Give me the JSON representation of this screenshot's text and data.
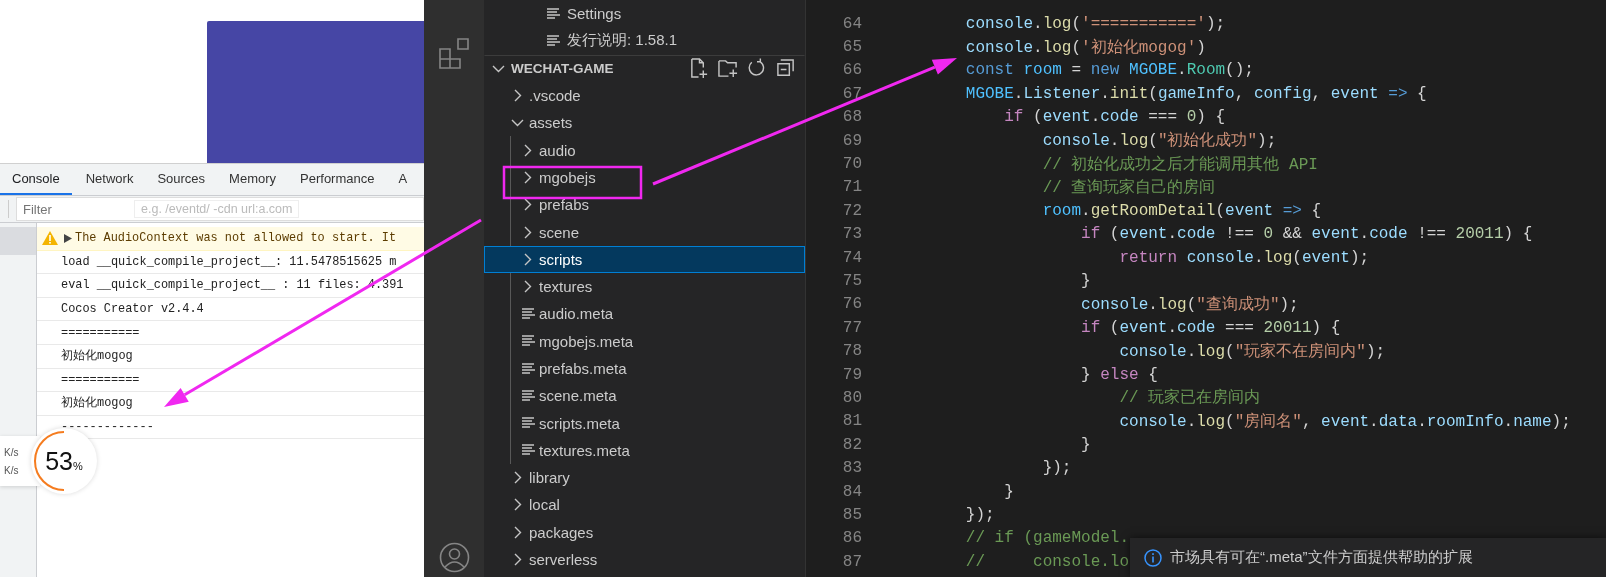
{
  "browser": {
    "devtools": {
      "tabs": [
        {
          "label": "Console",
          "selected": true
        },
        {
          "label": "Network",
          "selected": false
        },
        {
          "label": "Sources",
          "selected": false
        },
        {
          "label": "Memory",
          "selected": false
        },
        {
          "label": "Performance",
          "selected": false
        },
        {
          "label": "A",
          "selected": false
        }
      ],
      "filter": {
        "placeholder": "Filter"
      },
      "filter_hint": "e.g. /eventd/ -cdn url:a.com",
      "console_rows": [
        {
          "kind": "warning",
          "text": "The AudioContext was not allowed to start. It"
        },
        {
          "kind": "log",
          "text": "load __quick_compile_project__: 11.5478515625 m"
        },
        {
          "kind": "log",
          "text": "eval __quick_compile_project__ : 11 files: 4.391"
        },
        {
          "kind": "log",
          "text": "Cocos Creator v2.4.4"
        },
        {
          "kind": "log",
          "text": "==========="
        },
        {
          "kind": "log",
          "text": "初始化mogog"
        },
        {
          "kind": "log",
          "text": "==========="
        },
        {
          "kind": "log",
          "text": "初始化mogog"
        },
        {
          "kind": "log",
          "text": "-------------"
        }
      ]
    },
    "network_widget": {
      "upload_unit": "K/s",
      "download_unit": "K/s",
      "percent": "53",
      "percent_sign": "%",
      "level": 0.5
    }
  },
  "vscode": {
    "explorer": {
      "top_items": [
        {
          "label": "Settings"
        },
        {
          "label": "发行说明: 1.58.1"
        }
      ],
      "section": {
        "title": "WECHAT-GAME",
        "expanded": true
      },
      "tree": [
        {
          "label": ".vscode",
          "kind": "folder",
          "expanded": false,
          "selected": false
        },
        {
          "label": "assets",
          "kind": "folder",
          "expanded": true,
          "selected": false,
          "children": [
            {
              "label": "audio",
              "kind": "folder",
              "expanded": false,
              "selected": false
            },
            {
              "label": "mgobejs",
              "kind": "folder",
              "expanded": false,
              "selected": false
            },
            {
              "label": "prefabs",
              "kind": "folder",
              "expanded": false,
              "selected": false
            },
            {
              "label": "scene",
              "kind": "folder",
              "expanded": false,
              "selected": false
            },
            {
              "label": "scripts",
              "kind": "folder",
              "expanded": false,
              "selected": true
            },
            {
              "label": "textures",
              "kind": "folder",
              "expanded": false,
              "selected": false
            },
            {
              "label": "audio.meta",
              "kind": "file",
              "selected": false
            },
            {
              "label": "mgobejs.meta",
              "kind": "file",
              "selected": false
            },
            {
              "label": "prefabs.meta",
              "kind": "file",
              "selected": false
            },
            {
              "label": "scene.meta",
              "kind": "file",
              "selected": false
            },
            {
              "label": "scripts.meta",
              "kind": "file",
              "selected": false
            },
            {
              "label": "textures.meta",
              "kind": "file",
              "selected": false
            }
          ]
        },
        {
          "label": "library",
          "kind": "folder",
          "expanded": false,
          "selected": false
        },
        {
          "label": "local",
          "kind": "folder",
          "expanded": false,
          "selected": false
        },
        {
          "label": "packages",
          "kind": "folder",
          "expanded": false,
          "selected": false
        },
        {
          "label": "serverless",
          "kind": "folder",
          "expanded": false,
          "selected": false
        }
      ]
    },
    "editor": {
      "lines": [
        {
          "number": "64",
          "tokens": [
            {
              "kind": "var",
              "text": "        console"
            },
            {
              "kind": "pl",
              "text": "."
            },
            {
              "kind": "fn",
              "text": "log"
            },
            {
              "kind": "pl",
              "text": "("
            },
            {
              "kind": "str",
              "text": "'==========='"
            },
            {
              "kind": "pl",
              "text": ");"
            }
          ]
        },
        {
          "number": "65",
          "tokens": [
            {
              "kind": "var",
              "text": "        console"
            },
            {
              "kind": "pl",
              "text": "."
            },
            {
              "kind": "fn",
              "text": "log"
            },
            {
              "kind": "pl",
              "text": "("
            },
            {
              "kind": "str",
              "text": "'初始化mogog'"
            },
            {
              "kind": "pl",
              "text": ")"
            }
          ]
        },
        {
          "number": "66",
          "tokens": [
            {
              "kind": "kw",
              "text": "        const "
            },
            {
              "kind": "const",
              "text": "room"
            },
            {
              "kind": "pl",
              "text": " = "
            },
            {
              "kind": "kw",
              "text": "new "
            },
            {
              "kind": "const",
              "text": "MGOBE"
            },
            {
              "kind": "pl",
              "text": "."
            },
            {
              "kind": "cls",
              "text": "Room"
            },
            {
              "kind": "pl",
              "text": "();"
            }
          ]
        },
        {
          "number": "67",
          "tokens": [
            {
              "kind": "const",
              "text": "        MGOBE"
            },
            {
              "kind": "pl",
              "text": "."
            },
            {
              "kind": "var",
              "text": "Listener"
            },
            {
              "kind": "pl",
              "text": "."
            },
            {
              "kind": "fn",
              "text": "init"
            },
            {
              "kind": "pl",
              "text": "("
            },
            {
              "kind": "var",
              "text": "gameInfo"
            },
            {
              "kind": "pl",
              "text": ", "
            },
            {
              "kind": "var",
              "text": "config"
            },
            {
              "kind": "pl",
              "text": ", "
            },
            {
              "kind": "var",
              "text": "event "
            },
            {
              "kind": "kw",
              "text": "=>"
            },
            {
              "kind": "pl",
              "text": " {"
            }
          ]
        },
        {
          "number": "68",
          "tokens": [
            {
              "kind": "ctl",
              "text": "            if"
            },
            {
              "kind": "pl",
              "text": " ("
            },
            {
              "kind": "var",
              "text": "event"
            },
            {
              "kind": "pl",
              "text": "."
            },
            {
              "kind": "var",
              "text": "code"
            },
            {
              "kind": "pl",
              "text": " === "
            },
            {
              "kind": "num",
              "text": "0"
            },
            {
              "kind": "pl",
              "text": ") {"
            }
          ]
        },
        {
          "number": "69",
          "tokens": [
            {
              "kind": "var",
              "text": "                console"
            },
            {
              "kind": "pl",
              "text": "."
            },
            {
              "kind": "fn",
              "text": "log"
            },
            {
              "kind": "pl",
              "text": "("
            },
            {
              "kind": "str",
              "text": "\"初始化成功\""
            },
            {
              "kind": "pl",
              "text": ");"
            }
          ]
        },
        {
          "number": "70",
          "tokens": [
            {
              "kind": "cm",
              "text": "                // 初始化成功之后才能调用其他 API"
            }
          ]
        },
        {
          "number": "71",
          "tokens": [
            {
              "kind": "cm",
              "text": "                // 查询玩家自己的房间"
            }
          ]
        },
        {
          "number": "72",
          "tokens": [
            {
              "kind": "const",
              "text": "                room"
            },
            {
              "kind": "pl",
              "text": "."
            },
            {
              "kind": "fn",
              "text": "getRoomDetail"
            },
            {
              "kind": "pl",
              "text": "("
            },
            {
              "kind": "var",
              "text": "event "
            },
            {
              "kind": "kw",
              "text": "=>"
            },
            {
              "kind": "pl",
              "text": " {"
            }
          ]
        },
        {
          "number": "73",
          "tokens": [
            {
              "kind": "ctl",
              "text": "                    if"
            },
            {
              "kind": "pl",
              "text": " ("
            },
            {
              "kind": "var",
              "text": "event"
            },
            {
              "kind": "pl",
              "text": "."
            },
            {
              "kind": "var",
              "text": "code"
            },
            {
              "kind": "pl",
              "text": " !== "
            },
            {
              "kind": "num",
              "text": "0"
            },
            {
              "kind": "pl",
              "text": " && "
            },
            {
              "kind": "var",
              "text": "event"
            },
            {
              "kind": "pl",
              "text": "."
            },
            {
              "kind": "var",
              "text": "code"
            },
            {
              "kind": "pl",
              "text": " !== "
            },
            {
              "kind": "num",
              "text": "20011"
            },
            {
              "kind": "pl",
              "text": ") {"
            }
          ]
        },
        {
          "number": "74",
          "tokens": [
            {
              "kind": "ctl",
              "text": "                        return "
            },
            {
              "kind": "var",
              "text": "console"
            },
            {
              "kind": "pl",
              "text": "."
            },
            {
              "kind": "fn",
              "text": "log"
            },
            {
              "kind": "pl",
              "text": "("
            },
            {
              "kind": "var",
              "text": "event"
            },
            {
              "kind": "pl",
              "text": ");"
            }
          ]
        },
        {
          "number": "75",
          "tokens": [
            {
              "kind": "pl",
              "text": "                    }"
            }
          ]
        },
        {
          "number": "76",
          "tokens": [
            {
              "kind": "var",
              "text": "                    console"
            },
            {
              "kind": "pl",
              "text": "."
            },
            {
              "kind": "fn",
              "text": "log"
            },
            {
              "kind": "pl",
              "text": "("
            },
            {
              "kind": "str",
              "text": "\"查询成功\""
            },
            {
              "kind": "pl",
              "text": ");"
            }
          ]
        },
        {
          "number": "77",
          "tokens": [
            {
              "kind": "ctl",
              "text": "                    if"
            },
            {
              "kind": "pl",
              "text": " ("
            },
            {
              "kind": "var",
              "text": "event"
            },
            {
              "kind": "pl",
              "text": "."
            },
            {
              "kind": "var",
              "text": "code"
            },
            {
              "kind": "pl",
              "text": " === "
            },
            {
              "kind": "num",
              "text": "20011"
            },
            {
              "kind": "pl",
              "text": ") {"
            }
          ]
        },
        {
          "number": "78",
          "tokens": [
            {
              "kind": "var",
              "text": "                        console"
            },
            {
              "kind": "pl",
              "text": "."
            },
            {
              "kind": "fn",
              "text": "log"
            },
            {
              "kind": "pl",
              "text": "("
            },
            {
              "kind": "str",
              "text": "\"玩家不在房间内\""
            },
            {
              "kind": "pl",
              "text": ");"
            }
          ]
        },
        {
          "number": "79",
          "tokens": [
            {
              "kind": "pl",
              "text": "                    } "
            },
            {
              "kind": "ctl",
              "text": "else"
            },
            {
              "kind": "pl",
              "text": " {"
            }
          ]
        },
        {
          "number": "80",
          "tokens": [
            {
              "kind": "cm",
              "text": "                        // 玩家已在房间内"
            }
          ]
        },
        {
          "number": "81",
          "tokens": [
            {
              "kind": "var",
              "text": "                        console"
            },
            {
              "kind": "pl",
              "text": "."
            },
            {
              "kind": "fn",
              "text": "log"
            },
            {
              "kind": "pl",
              "text": "("
            },
            {
              "kind": "str",
              "text": "\"房间名\""
            },
            {
              "kind": "pl",
              "text": ", "
            },
            {
              "kind": "var",
              "text": "event"
            },
            {
              "kind": "pl",
              "text": "."
            },
            {
              "kind": "var",
              "text": "data"
            },
            {
              "kind": "pl",
              "text": "."
            },
            {
              "kind": "var",
              "text": "roomInfo"
            },
            {
              "kind": "pl",
              "text": "."
            },
            {
              "kind": "var",
              "text": "name"
            },
            {
              "kind": "pl",
              "text": ");"
            }
          ]
        },
        {
          "number": "82",
          "tokens": [
            {
              "kind": "pl",
              "text": "                    }"
            }
          ]
        },
        {
          "number": "83",
          "tokens": [
            {
              "kind": "pl",
              "text": "                });"
            }
          ]
        },
        {
          "number": "84",
          "tokens": [
            {
              "kind": "pl",
              "text": "            }"
            }
          ]
        },
        {
          "number": "85",
          "tokens": [
            {
              "kind": "pl",
              "text": "        });"
            }
          ]
        },
        {
          "number": "86",
          "tokens": [
            {
              "kind": "cm",
              "text": "        // if (gameModel."
            }
          ]
        },
        {
          "number": "87",
          "tokens": [
            {
              "kind": "cm",
              "text": "        //     console.lo"
            }
          ]
        }
      ]
    },
    "notification": {
      "text": "市场具有可在“.meta”文件方面提供帮助的扩展"
    }
  }
}
